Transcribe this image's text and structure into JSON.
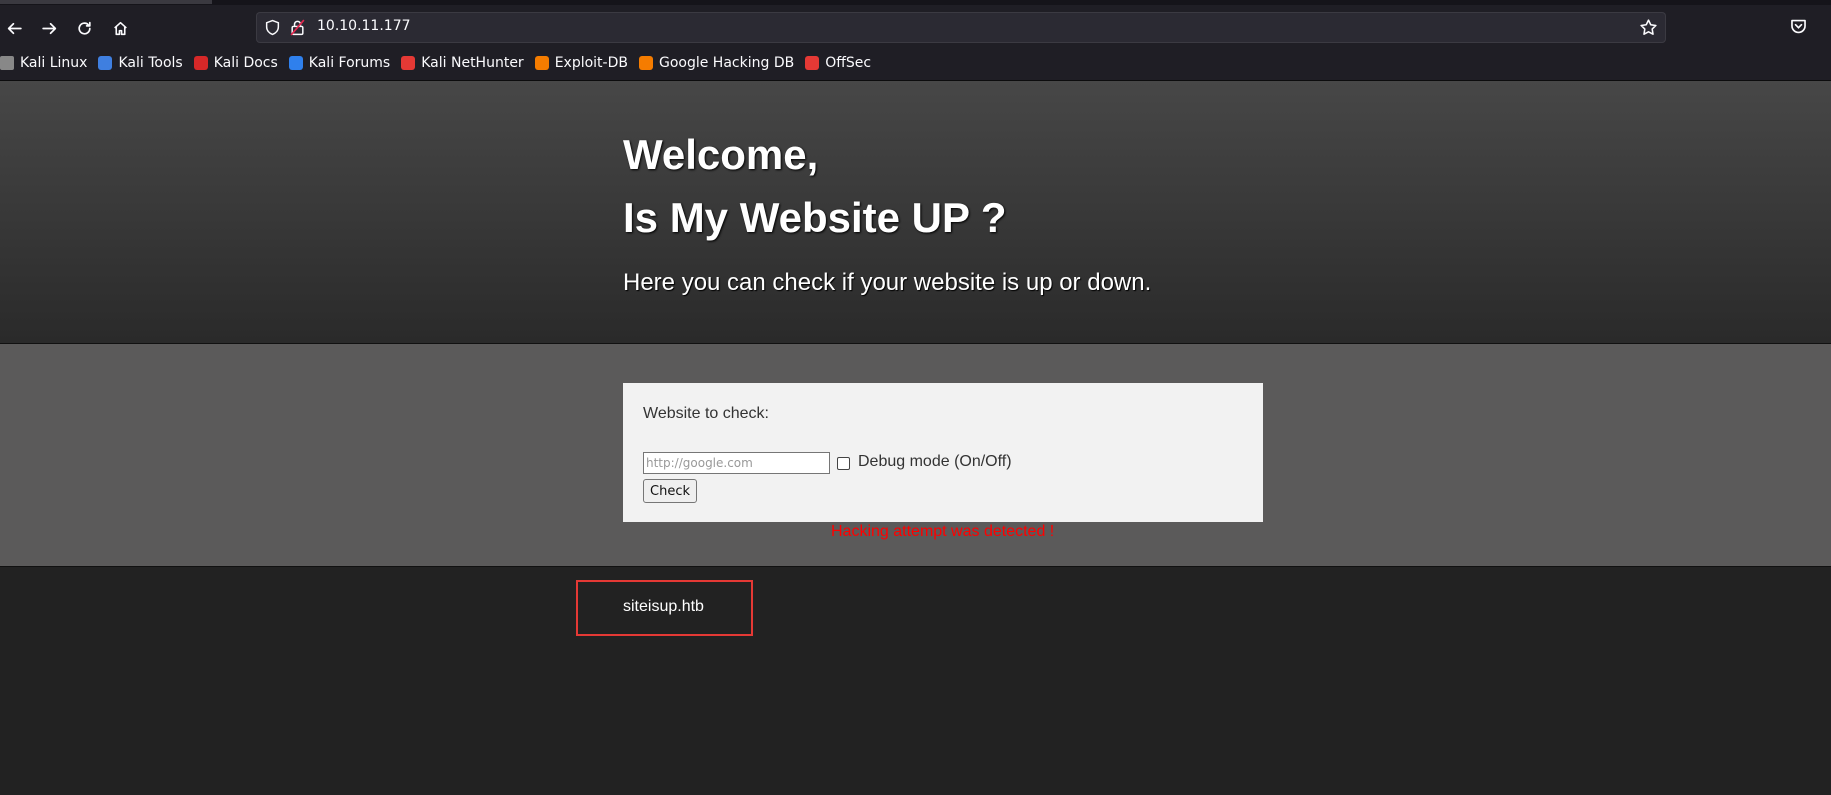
{
  "browser": {
    "url": "10.10.11.177",
    "bookmarks": [
      {
        "label": "Kali Linux",
        "icon": "kali-dragon-icon",
        "color": "#888888"
      },
      {
        "label": "Kali Tools",
        "icon": "kali-tools-icon",
        "color": "#3f7fe0"
      },
      {
        "label": "Kali Docs",
        "icon": "kali-docs-icon",
        "color": "#d62828"
      },
      {
        "label": "Kali Forums",
        "icon": "kali-forums-icon",
        "color": "#2f80ed"
      },
      {
        "label": "Kali NetHunter",
        "icon": "nethunter-icon",
        "color": "#e53935"
      },
      {
        "label": "Exploit-DB",
        "icon": "exploit-db-icon",
        "color": "#f57c00"
      },
      {
        "label": "Google Hacking DB",
        "icon": "ghdb-icon",
        "color": "#f57c00"
      },
      {
        "label": "OffSec",
        "icon": "offsec-icon",
        "color": "#e53935"
      }
    ]
  },
  "hero": {
    "title_line1": "Welcome,",
    "title_line2": "Is My Website UP ?",
    "subtitle": "Here you can check if your website is up or down."
  },
  "form": {
    "label": "Website to check:",
    "input_placeholder": "http://google.com",
    "input_value": "",
    "debug_label": "Debug mode (On/Off)",
    "debug_checked": false,
    "button_label": "Check"
  },
  "alert": {
    "text": "Hacking attempt was detected !",
    "color": "#ff0000"
  },
  "footer": {
    "text": "siteisup.htb",
    "highlight_color": "#e53935"
  }
}
